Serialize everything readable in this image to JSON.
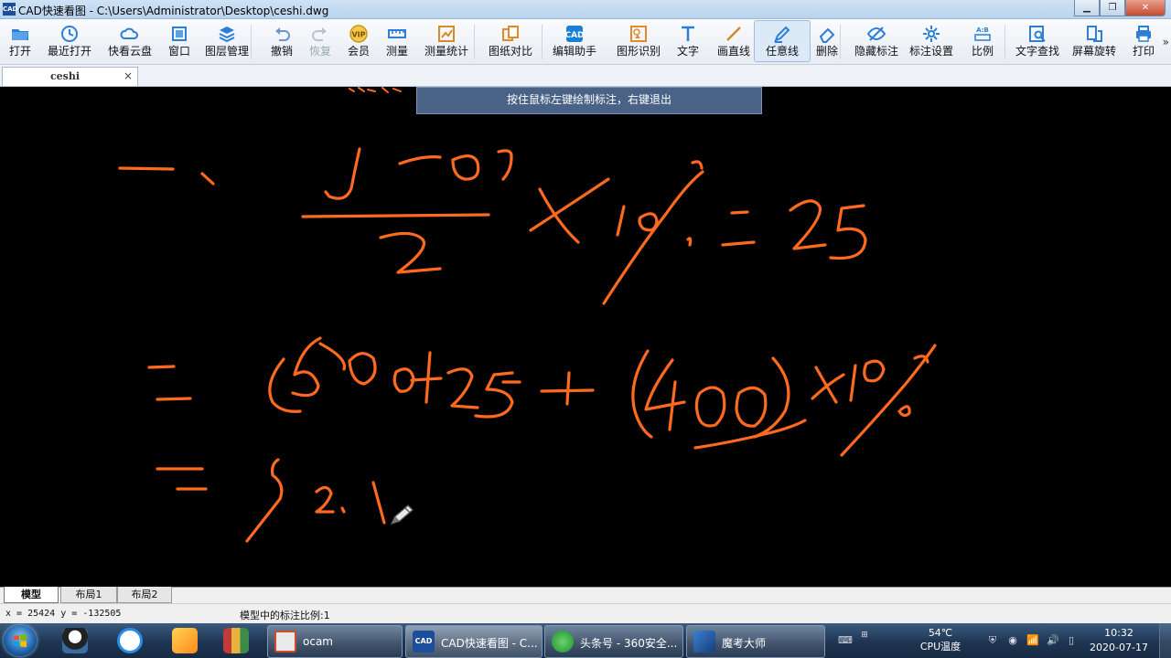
{
  "window": {
    "title": "CAD快速看图 - C:\\Users\\Administrator\\Desktop\\ceshi.dwg",
    "app_icon_text": "CAD"
  },
  "toolbar": {
    "items": [
      {
        "label": "打开",
        "icon": "folder-open-icon"
      },
      {
        "label": "最近打开",
        "icon": "clock-icon"
      },
      {
        "label": "快看云盘",
        "icon": "cloud-icon"
      },
      {
        "label": "窗口",
        "icon": "window-icon"
      },
      {
        "label": "图层管理",
        "icon": "layers-icon"
      },
      {
        "label": "撤销",
        "icon": "undo-icon"
      },
      {
        "label": "恢复",
        "icon": "redo-icon"
      },
      {
        "label": "会员",
        "icon": "vip-icon"
      },
      {
        "label": "测量",
        "icon": "ruler-icon"
      },
      {
        "label": "测量统计",
        "icon": "measure-stats-icon"
      },
      {
        "label": "图纸对比",
        "icon": "compare-icon"
      },
      {
        "label": "编辑助手",
        "icon": "edit-helper-icon"
      },
      {
        "label": "图形识别",
        "icon": "shape-recognize-icon"
      },
      {
        "label": "文字",
        "icon": "text-icon"
      },
      {
        "label": "画直线",
        "icon": "line-icon"
      },
      {
        "label": "任意线",
        "icon": "pencil-icon"
      },
      {
        "label": "删除",
        "icon": "eraser-icon"
      },
      {
        "label": "隐藏标注",
        "icon": "eye-icon"
      },
      {
        "label": "标注设置",
        "icon": "settings-icon"
      },
      {
        "label": "比例",
        "icon": "scale-icon"
      },
      {
        "label": "文字查找",
        "icon": "text-search-icon"
      },
      {
        "label": "屏幕旋转",
        "icon": "rotate-icon"
      },
      {
        "label": "打印",
        "icon": "printer-icon"
      }
    ],
    "more": "»"
  },
  "document_tab": {
    "name": "ceshi",
    "close": "×"
  },
  "canvas": {
    "hint": "按住鼠标左键绘制标注，右键退出",
    "stroke_color": "#ff6a1f"
  },
  "layout_tabs": [
    {
      "label": "模型",
      "active": true
    },
    {
      "label": "布局1",
      "active": false
    },
    {
      "label": "布局2",
      "active": false
    }
  ],
  "status": {
    "coords": "x = 25424   y = -132505",
    "scale": "模型中的标注比例:1"
  },
  "taskbar": {
    "pinned": [
      "qq-icon",
      "baidu-netdisk-icon",
      "app-k-icon",
      "winrar-icon"
    ],
    "tasks": [
      {
        "label": "ocam",
        "active": false
      },
      {
        "label": "CAD快速看图 - C...",
        "active": true
      },
      {
        "label": "头条号 - 360安全...",
        "active": false
      },
      {
        "label": "魔考大师",
        "active": false
      }
    ],
    "temperature": "54℃",
    "temperature_label": "CPU温度",
    "time": "10:32",
    "date": "2020-07-17"
  },
  "colors": {
    "accent": "#1a7fd6",
    "ink": "#ff6a1f"
  }
}
